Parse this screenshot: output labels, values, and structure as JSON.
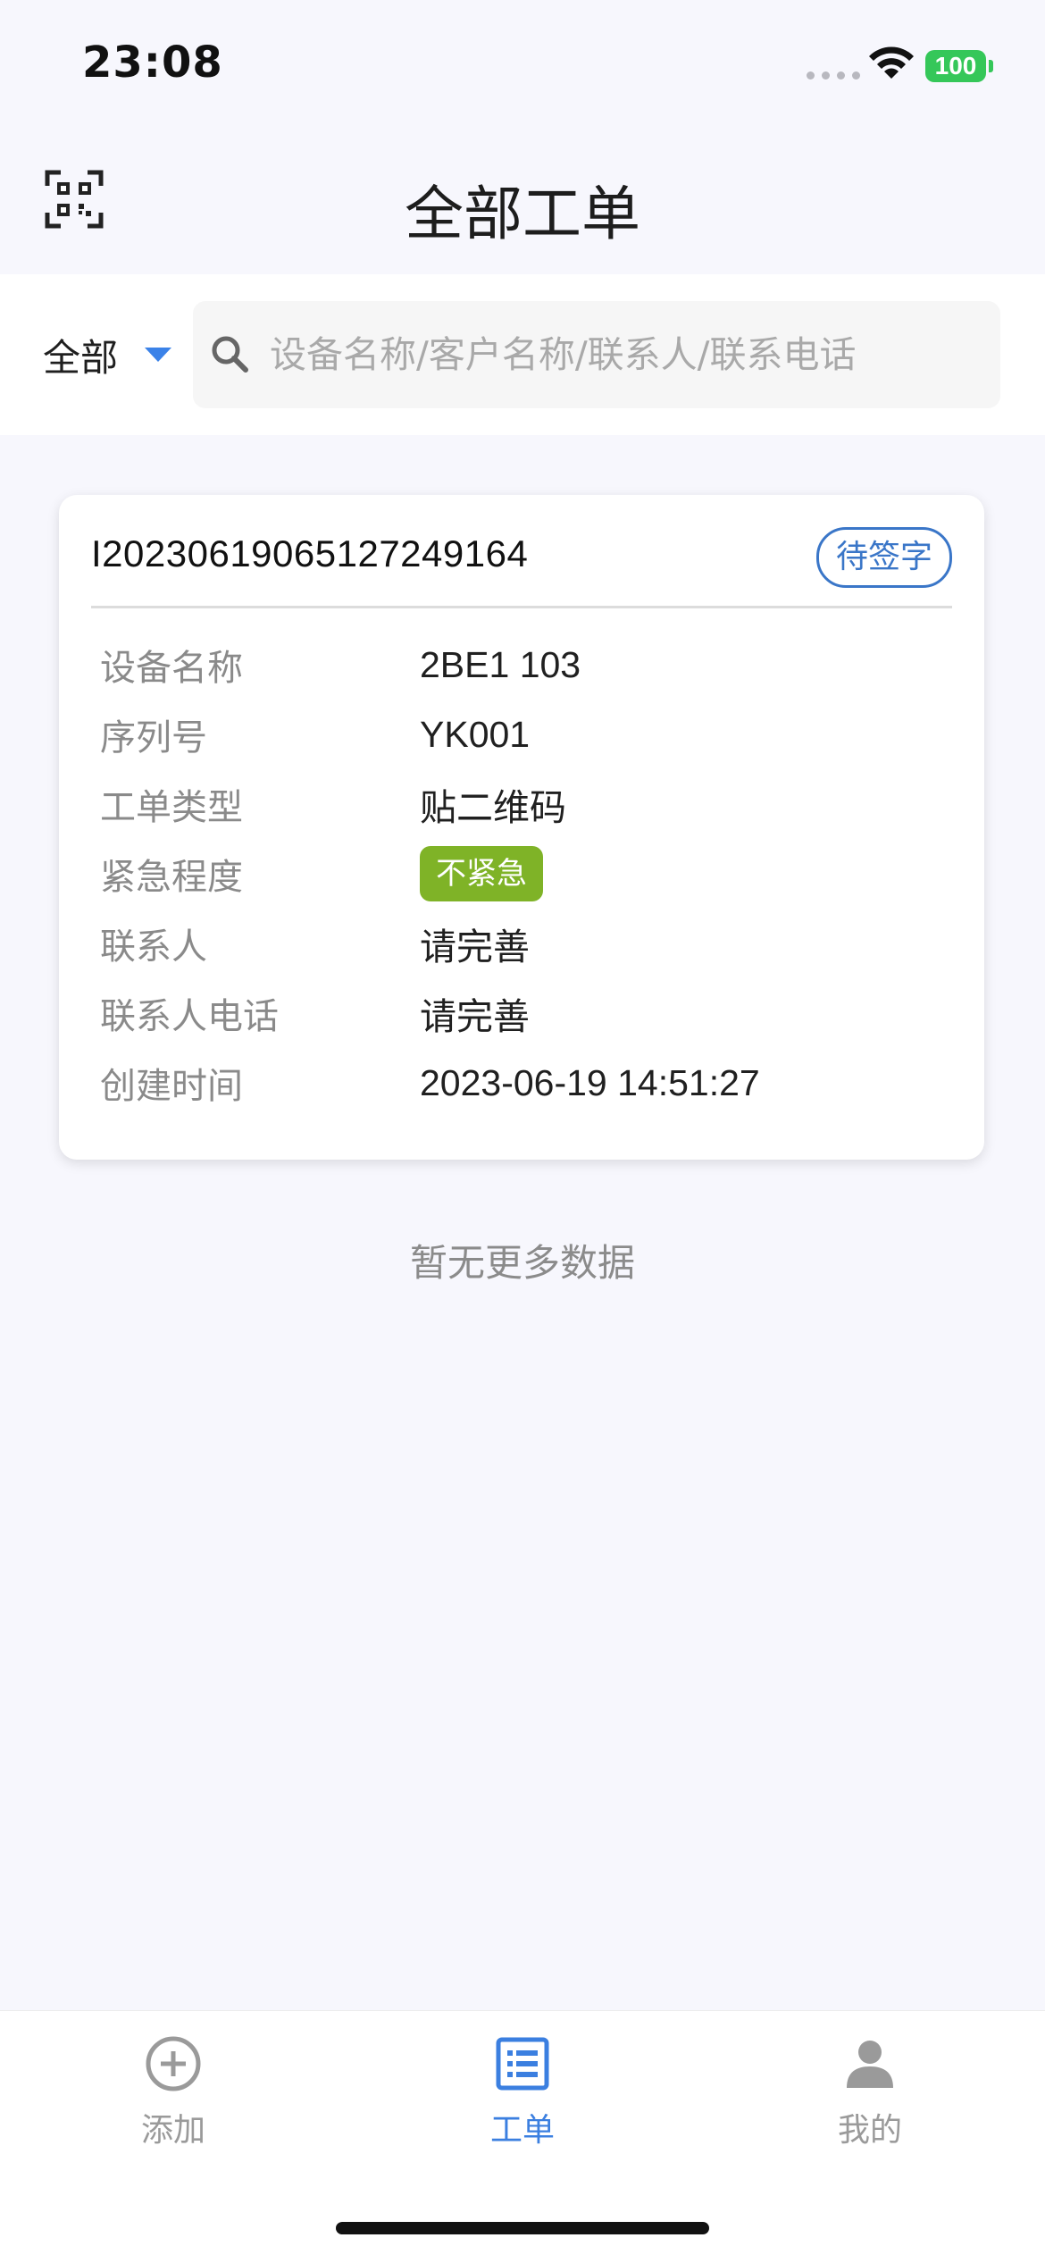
{
  "status_bar": {
    "time": "23:08",
    "battery": "100"
  },
  "header": {
    "title": "全部工单",
    "scan_icon": "qr-scan-icon"
  },
  "filter": {
    "selected": "全部",
    "search_placeholder": "设备名称/客户名称/联系人/联系电话"
  },
  "order_card": {
    "order_no": "I20230619065127249164",
    "status": "待签字",
    "fields": [
      {
        "label": "设备名称",
        "value": "2BE1 103"
      },
      {
        "label": "序列号",
        "value": "YK001"
      },
      {
        "label": "工单类型",
        "value": "贴二维码"
      },
      {
        "label": "紧急程度",
        "value": "不紧急"
      },
      {
        "label": "联系人",
        "value": "请完善"
      },
      {
        "label": "联系人电话",
        "value": "请完善"
      },
      {
        "label": "创建时间",
        "value": "2023-06-19 14:51:27"
      }
    ]
  },
  "empty_hint": "暂无更多数据",
  "tab_bar": {
    "tabs": [
      {
        "label": "添加",
        "icon": "add-circle-icon",
        "active": false
      },
      {
        "label": "工单",
        "icon": "list-icon",
        "active": true
      },
      {
        "label": "我的",
        "icon": "person-icon",
        "active": false
      }
    ]
  },
  "colors": {
    "accent": "#3b7fe0",
    "status_border": "#3a76c8",
    "urgency_green": "#7fb327",
    "battery_green": "#35c759"
  }
}
